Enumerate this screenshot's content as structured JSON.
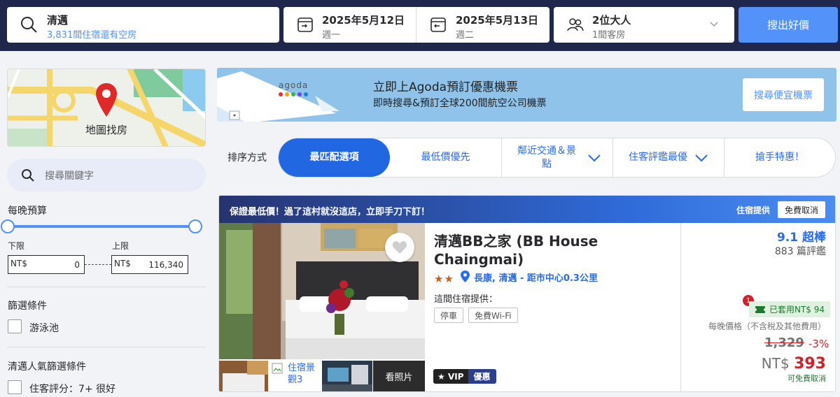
{
  "search": {
    "destination": "清邁",
    "availability": "3,831間住宿還有空房",
    "checkin_date": "2025年5月12日",
    "checkin_day": "週一",
    "checkout_date": "2025年5月13日",
    "checkout_day": "週二",
    "guests": "2位大人",
    "rooms": "1間客房",
    "button": "搜出好價"
  },
  "sidebar": {
    "map_label": "地圖找房",
    "keyword_placeholder": "搜尋關鍵字",
    "budget_title": "每晚預算",
    "min_label": "下限",
    "max_label": "上限",
    "currency": "NT$",
    "min_value": "0",
    "max_value": "116,340",
    "filter_title": "篩選條件",
    "filter_pool": "游泳池",
    "popular_title": "清邁人氣篩選條件",
    "popular_rating": "住客評分：7+ 很好"
  },
  "banner": {
    "logo_text": "agoda",
    "headline": "立即上Agoda預訂優惠機票",
    "subline": "即時搜尋&預訂全球200間航空公司機票",
    "button": "搜尋便宜機票"
  },
  "sort": {
    "label": "排序方式",
    "options": [
      "最匹配選項",
      "最低價優先",
      "鄰近交通＆景點",
      "住客評鑑最優",
      "搶手特惠！"
    ]
  },
  "hotel": {
    "promo": "保證最低價！過了這村就沒這店，立即手刀下訂！",
    "provider": "住宿提供",
    "free_cancel_badge": "免費取消",
    "name": "清邁BB之家 (BB House Chaingmai)",
    "stars": "★★",
    "location": "長康, 清邁 - 距市中心0.3公里",
    "provides": "這間住宿提供：",
    "amenities": [
      "停車",
      "免費Wi-Fi"
    ],
    "thumb_alt": "住宿景觀3",
    "more_photos": "看照片",
    "vip": "VIP",
    "vip_deal": "優惠",
    "score": "9.1 超棒",
    "reviews": "883 篇評鑑",
    "coupon_count": "1",
    "coupon": "已套用NT$ 94",
    "nightly_note": "每晚價格（不含稅及其他費用）",
    "original_price": "1,329",
    "discount": "-3%",
    "currency": "NT$",
    "price": "393",
    "free_cancel": "可免費取消"
  },
  "colors": {
    "header_bg": "#20274d",
    "accent": "#5392f9",
    "link": "#2a6be8",
    "price_red": "#d0222a"
  }
}
